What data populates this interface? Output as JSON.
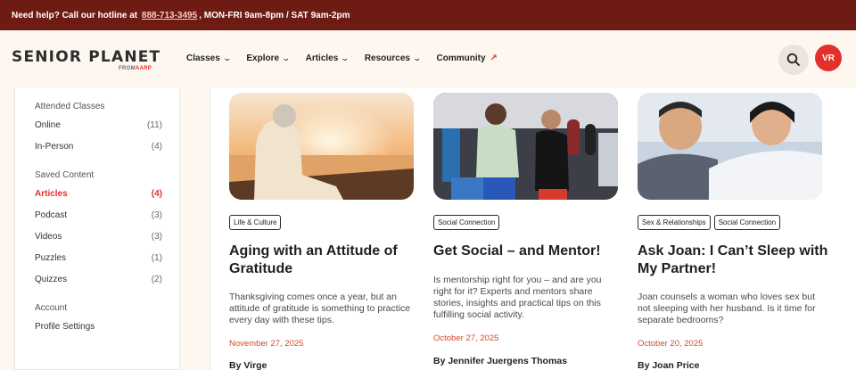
{
  "topbar": {
    "prefix": "Need help? Call our hotline at",
    "phone": "888-713-3495",
    "hours": ", MON-FRI 9am-8pm / SAT 9am-2pm"
  },
  "logo": {
    "text": "SENIOR PLANET",
    "from": "FROM",
    "brand": "AARP"
  },
  "nav": [
    {
      "label": "Classes"
    },
    {
      "label": "Explore"
    },
    {
      "label": "Articles"
    },
    {
      "label": "Resources"
    },
    {
      "label": "Community"
    }
  ],
  "user": {
    "initials": "VR"
  },
  "sidebar": {
    "attended_heading": "Attended Classes",
    "attended": [
      {
        "label": "Online",
        "count": "(11)"
      },
      {
        "label": "In-Person",
        "count": "(4)"
      }
    ],
    "saved_heading": "Saved Content",
    "saved": [
      {
        "label": "Articles",
        "count": "(4)"
      },
      {
        "label": "Podcast",
        "count": "(3)"
      },
      {
        "label": "Videos",
        "count": "(3)"
      },
      {
        "label": "Puzzles",
        "count": "(1)"
      },
      {
        "label": "Quizzes",
        "count": "(2)"
      }
    ],
    "account_heading": "Account",
    "profile_settings": "Profile Settings"
  },
  "cards": [
    {
      "tags": [
        "Life & Culture"
      ],
      "title": "Aging with an Attitude of Gratitude",
      "excerpt": "Thanksgiving comes once a year, but an attitude of gratitude is something to practice every day with these tips.",
      "date": "November 27, 2025",
      "byline": "By Virge"
    },
    {
      "tags": [
        "Social Connection"
      ],
      "title": "Get Social – and Mentor!",
      "excerpt": "Is mentorship right for you – and are you right for it? Experts and mentors share stories, insights and practical tips on this fulfilling social activity.",
      "date": "October 27, 2025",
      "byline": "By Jennifer Juergens Thomas"
    },
    {
      "tags": [
        "Sex & Relationships",
        "Social Connection"
      ],
      "title": "Ask Joan: I Can’t Sleep with My Partner!",
      "excerpt": "Joan counsels a woman who loves sex but not sleeping with her husband. Is it time for separate bedrooms?",
      "date": "October 20, 2025",
      "byline": "By Joan Price"
    }
  ],
  "colors": {
    "topbar": "#6e1b14",
    "accent": "#e3302b",
    "date": "#d64a2a",
    "background": "#fdf7f0"
  }
}
